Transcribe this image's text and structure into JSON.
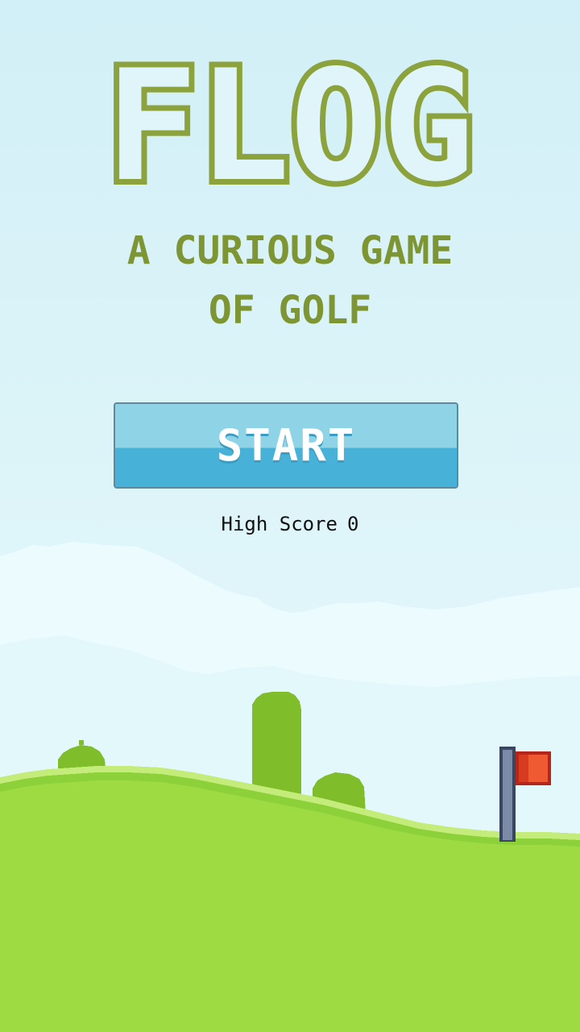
{
  "game": {
    "title": "FLOG",
    "subtitle_line1": "A CURIOUS GAME",
    "subtitle_line2": "OF GOLF",
    "start_label": "START",
    "high_score_label": "High Score",
    "high_score_value": "0"
  },
  "colors": {
    "title_outline": "#8ca23c",
    "button_top": "#8fd4e6",
    "button_bottom": "#48b1d8",
    "grass": "#9edb42",
    "flag": "#ee5430"
  }
}
